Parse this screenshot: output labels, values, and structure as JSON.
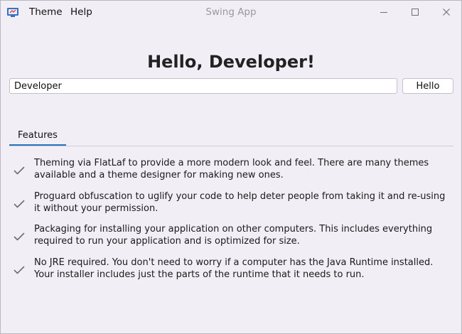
{
  "window": {
    "title": "Swing App",
    "icons": {
      "app": "java-app-icon",
      "minimize": "minimize-icon",
      "maximize": "maximize-icon",
      "close": "close-icon"
    }
  },
  "menubar": {
    "items": [
      {
        "label": "Theme"
      },
      {
        "label": "Help"
      }
    ]
  },
  "main": {
    "heading": "Hello, Developer!",
    "name_input": {
      "value": "Developer",
      "placeholder": ""
    },
    "hello_button": "Hello"
  },
  "tabs": [
    {
      "label": "Features",
      "selected": true
    }
  ],
  "features": [
    {
      "icon": "check-icon",
      "text": "Theming via FlatLaf to provide a more modern look and feel. There are many themes available and a theme designer for making new ones."
    },
    {
      "icon": "check-icon",
      "text": "Proguard obfuscation to uglify your code to help deter people from taking it and re-using it without your permission."
    },
    {
      "icon": "check-icon",
      "text": "Packaging for installing your application on other computers. This includes everything required to run your application and is optimized for size."
    },
    {
      "icon": "check-icon",
      "text": "No JRE required. You don't need to worry if a computer has the Java Runtime installed. Your installer includes just the parts of the runtime that it needs to run."
    }
  ],
  "colors": {
    "background": "#f1eff5",
    "accent": "#2675bf",
    "title_text": "#9a97a0"
  }
}
